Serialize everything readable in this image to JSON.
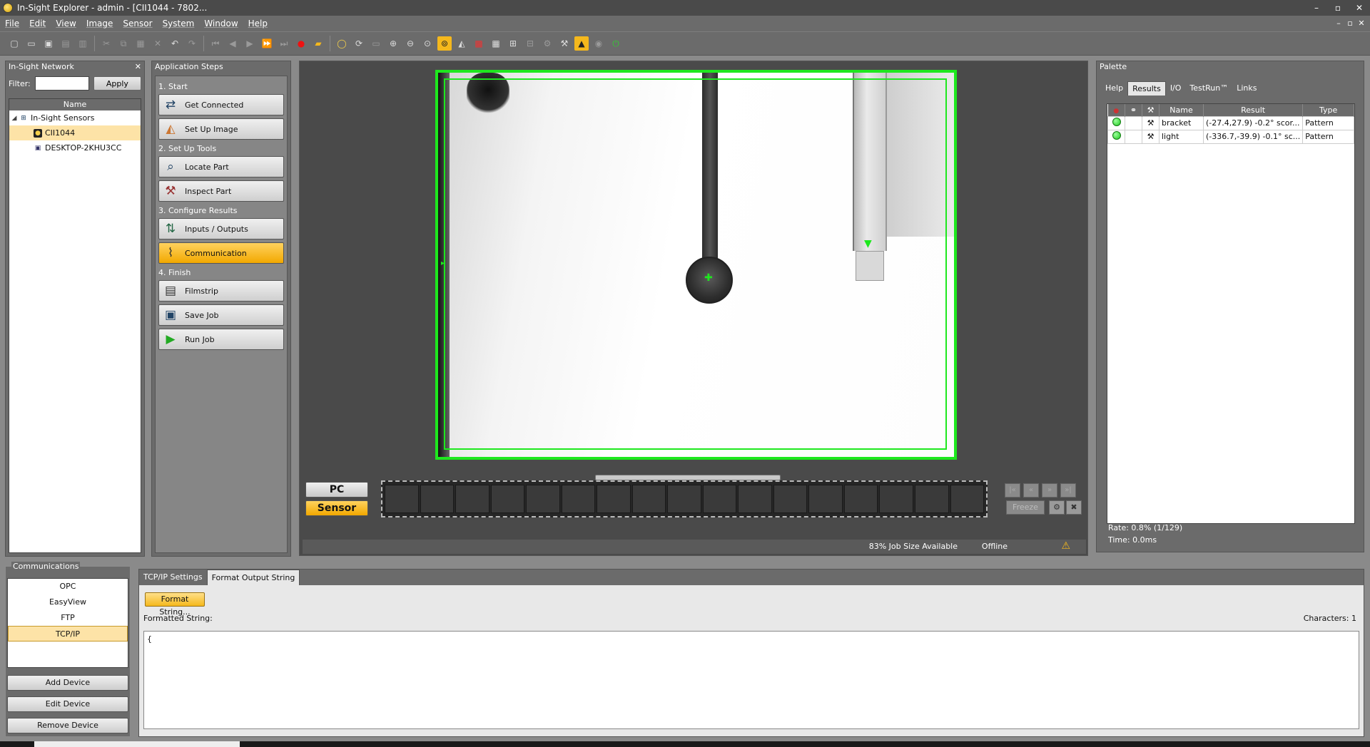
{
  "window": {
    "title": "In-Sight Explorer - admin - [CII1044 - 7802...",
    "controls": [
      "–",
      "▫",
      "✕"
    ]
  },
  "menu": {
    "items": [
      "File",
      "Edit",
      "View",
      "Image",
      "Sensor",
      "System",
      "Window",
      "Help"
    ],
    "mdi_controls": [
      "–",
      "▫",
      "✕"
    ]
  },
  "network": {
    "title": "In-Sight Network",
    "filter_label": "Filter:",
    "filter_value": "",
    "apply_label": "Apply",
    "column": "Name",
    "tree": [
      {
        "label": "In-Sight Sensors",
        "level": 0,
        "selected": false
      },
      {
        "label": "CII1044",
        "level": 1,
        "selected": true
      },
      {
        "label": "DESKTOP-2KHU3CC",
        "level": 1,
        "selected": false
      }
    ]
  },
  "steps": {
    "title": "Application Steps",
    "groups": [
      {
        "label": "1. Start",
        "buttons": [
          {
            "label": "Get Connected",
            "icon": "connect-icon"
          },
          {
            "label": "Set Up Image",
            "icon": "image-icon"
          }
        ]
      },
      {
        "label": "2. Set Up Tools",
        "buttons": [
          {
            "label": "Locate Part",
            "icon": "magnifier-icon"
          },
          {
            "label": "Inspect Part",
            "icon": "tools-icon"
          }
        ]
      },
      {
        "label": "3. Configure Results",
        "buttons": [
          {
            "label": "Inputs / Outputs",
            "icon": "io-icon"
          },
          {
            "label": "Communication",
            "icon": "comm-icon",
            "active": true
          }
        ]
      },
      {
        "label": "4. Finish",
        "buttons": [
          {
            "label": "Filmstrip",
            "icon": "filmstrip-icon"
          },
          {
            "label": "Save Job",
            "icon": "save-icon"
          },
          {
            "label": "Run Job",
            "icon": "play-icon"
          }
        ]
      }
    ]
  },
  "viewer": {
    "pc_label": "PC",
    "sensor_label": "Sensor",
    "freeze_label": "Freeze",
    "job_size": "83% Job Size Available",
    "status": "Offline"
  },
  "palette": {
    "title": "Palette",
    "tabs": [
      "Help",
      "Results",
      "I/O",
      "TestRun™",
      "Links"
    ],
    "active_tab": "Results",
    "columns": [
      "",
      "",
      "",
      "Name",
      "Result",
      "Type"
    ],
    "rows": [
      {
        "name": "bracket",
        "result": "(-27.4,27.9) -0.2° scor...",
        "type": "Pattern"
      },
      {
        "name": "light",
        "result": "(-336.7,-39.9) -0.1° sc...",
        "type": "Pattern"
      }
    ],
    "rate": "Rate: 0.8% (1/129)",
    "time": "Time: 0.0ms"
  },
  "comms": {
    "title": "Communications",
    "items": [
      "OPC",
      "EasyView",
      "FTP",
      "TCP/IP"
    ],
    "selected": "TCP/IP",
    "add": "Add Device",
    "edit": "Edit Device",
    "remove": "Remove Device"
  },
  "bottom": {
    "tabs": [
      "TCP/IP Settings",
      "Format Output String"
    ],
    "active_tab": "Format Output String",
    "format_button": "Format String...",
    "formatted_label": "Formatted String:",
    "characters": "Characters: 1",
    "formatted_value": "{"
  },
  "colors": {
    "accent": "#f5b81c",
    "selection": "#fde3a7",
    "overlay_green": "#1ee81e",
    "chrome": "#6b6b6b"
  }
}
